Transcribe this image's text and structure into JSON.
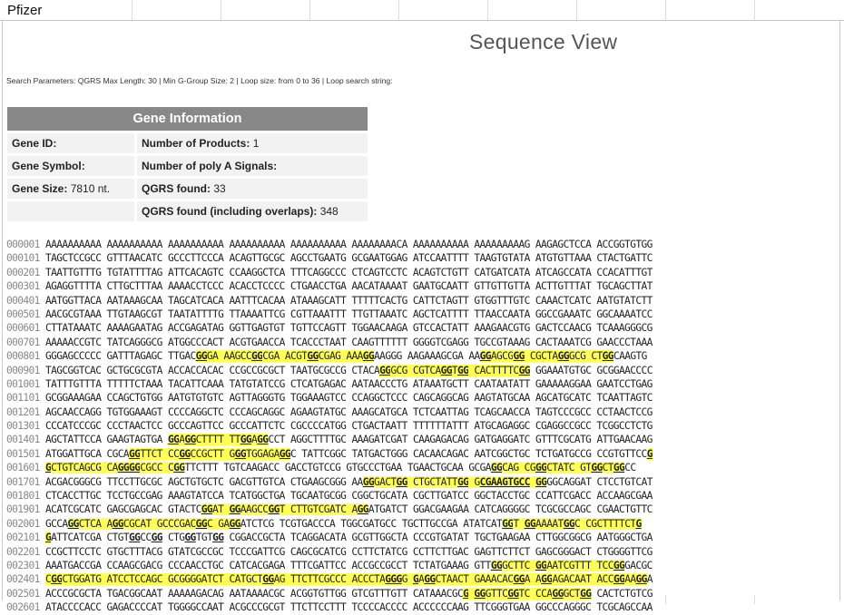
{
  "app": {
    "label": "Pfizer"
  },
  "page": {
    "title": "Sequence View",
    "search_parameters": "Search Parameters: QGRS Max Length: 30 | Min G-Group Size: 2 | Loop size: from 0 to 36 | Loop search string:"
  },
  "gene_info": {
    "header": "Gene Information",
    "rows": [
      {
        "label1": "Gene ID:",
        "value1": "",
        "label2": "Number of Products:",
        "value2": "1"
      },
      {
        "label1": "Gene Symbol:",
        "value1": "",
        "label2": "Number of poly A Signals:",
        "value2": ""
      },
      {
        "label1": "Gene Size:",
        "value1": "7810 nt.",
        "label2": "QGRS found:",
        "value2": "33"
      },
      {
        "label1": "",
        "value1": "",
        "label2": "QGRS found (including overlaps):",
        "value2": "348"
      }
    ]
  },
  "sequence": {
    "markup_legend": "[..] = highlighted QGRS region, {..} = G-group (bold underline)",
    "rows": [
      {
        "num": "000001",
        "seq": "AAAAAAAAAA AAAAAAAAAA AAAAAAAAAA AAAAAAAAAA AAAAAAAAAA AAAAAAAACA AAAAAAAAAA AAAAAAAAAG AAGAGCTCCA ACCGGTGTGG"
      },
      {
        "num": "000101",
        "seq": "TAGCTCCGCC GTTTAACATC GCCCTTCCCA ACAGTTGCGC AGCCTGAATG GCGAATGGAG ATCCAATTTT TAAGTGTATA ATGTGTTAAA CTACTGATTC"
      },
      {
        "num": "000201",
        "seq": "TAATTGTTTG TGTATTTTAG ATTCACAGTC CCAAGGCTCA TTTCAGGCCC CTCAGTCCTC ACAGTCTGTT CATGATCATA ATCAGCCATA CCACATTTGT"
      },
      {
        "num": "000301",
        "seq": "AGAGGTTTTA CTTGCTTTAA AAAACCTCCC ACACCTCCCC CTGAACCTGA AACATAAAAT GAATGCAATT GTTGTTGTTA ACTTGTTTAT TGCAGCTTAT"
      },
      {
        "num": "000401",
        "seq": "AATGGTTACA AATAAAGCAA TAGCATCACA AATTTCACAA ATAAAGCATT TTTTTCACTG CATTCTAGTT GTGGTTTGTC CAAACTCATC AATGTATCTT"
      },
      {
        "num": "000501",
        "seq": "AACGCGTAAA TTGTAAGCGT TAATATTTTG TTAAAATTCG CGTTAAATTT TTGTTAAATC AGCTCATTTT TTAACCAATA GGCCGAAATC GGCAAAATCC"
      },
      {
        "num": "000601",
        "seq": "CTTATAAATC AAAAGAATAG ACCGAGATAG GGTTGAGTGT TGTTCCAGTT TGGAACAAGA GTCCACTATT AAAGAACGTG GACTCCAACG TCAAAGGGCG"
      },
      {
        "num": "000701",
        "seq": "AAAAACCGTC TATCAGGGCG ATGGCCCACT ACGTGAACCA TCACCCTAAT CAAGTTTTTT GGGGTCGAGG TGCCGTAAAG CACTAAATCG GAACCCTAAA"
      },
      {
        "num": "000801",
        "seq": "GGGAGCCCCC GATTTAGAGC TTGAC[{GG}GA AAGCC{GG}CGA ACGT{GG}CGAG AAA{GG}]AAGGG AAGAAAGCGA AA[{GG}AGCG{GG} CGCTA{GG}GCG CT{GG}]CAAGTG"
      },
      {
        "num": "000901",
        "seq": "TAGCGGTCAC GCTGCGCGTA ACCACCACAC CCGCCGCGCT TAATGCGCCG CTACA[{GG}GCG CGTCA{GG}T{GG} CACTTTTC{GG}] GGAAATGTGC GCGGAACCCC"
      },
      {
        "num": "001001",
        "seq": "TATTTGTTTA TTTTTCTAAA TACATTCAAA TATGTATCCG CTCATGAGAC AATAACCCTG ATAAATGCTT CAATAATATT GAAAAAGGAA GAATCCTGAG"
      },
      {
        "num": "001101",
        "seq": "GCGGAAAGAA CCAGCTGTGG AATGTGTGTC AGTTAGGGTG TGGAAAGTCC CCAGGCTCCC CAGCAGGCAG AAGTATGCAA AGCATGCATC TCAATTAGTC"
      },
      {
        "num": "001201",
        "seq": "AGCAACCAGG TGTGGAAAGT CCCCAGGCTC CCCAGCAGGC AGAAGTATGC AAAGCATGCA TCTCAATTAG TCAGCAACCA TAGTCCCGCC CCTAACTCCG"
      },
      {
        "num": "001301",
        "seq": "CCCATCCCGC CCCTAACTCC GCCCAGTTCC GCCCATTCTC CGCCCCATGG CTGACTAATT TTTTTTATTT ATGCAGAGGC CGAGGCCGCC TCGGCCTCTG"
      },
      {
        "num": "001401",
        "seq": "AGCTATTCCA GAAGTAGTGA [{GG}A{GG}CTTTT TT{GG}A{GG}]CCT AGGCTTTTGC AAAGATCGAT CAAGAGACAG GATGAGGATC GTTTCGCATG ATTGAACAAG"
      },
      {
        "num": "001501",
        "seq": "ATGGATTGCA CGCA[{GG}TTCT CC{GG}CCGCTT G{GG}TGGAGA{G}{G}]C TATTCGGC TATGACTGGG CACAACAGAC AATCGGCTGC TCTGATGCCG CCGTGTTCC[{G}"
      },
      {
        "num": "001601",
        "seq": "{G}CTGTCAGCG CA{GGGG}CGCC C{GG}]TTCTTT TGTCAAGACC GACCTGTCCG GTGCCCTGAA TGAACTGCAA GCGA[{GG}CAG CG{GG}CTATC GT{GG}CT{GG}]CC"
      },
      {
        "num": "001701",
        "seq": "ACGACGGGCG TTCCTTGCGC AGCTGTGCTC GACGTTGTCA CTGAAGCGGG AA[{GG}GACT{GG} CTGCTATT{GG} G{CGAAGTGCC} {GG}]GGCAGGAT CTCCTGTCAT"
      },
      {
        "num": "001801",
        "seq": "CTCACCTTGC TCCTGCCGAG AAAGTATCCA TCATGGCTGA TGCAATGCGG CGGCTGCATA CGCTTGATCC GGCTACCTGC CCATTCGACC ACCAAGCGAA"
      },
      {
        "num": "001901",
        "seq": "ACATCGCATC GAGCGAGCAC GTACTC[{GG}AT {GG}AAGCC{GG}T CTTGTCGATC A{GG}]ATGATCT GGACGAAGAA CATCAGGGGC TCGCGCCAGC CGAACTGTTC"
      },
      {
        "num": "002001",
        "seq": "GCCA[{GG}CTCA A{GG}CGCAT GCCCGAC{GG}C GA{GG}]ATCTCG TCGTGACCCA TGGCGATGCC TGCTTGCCGA ATATCAT[{GG}T {GG}AAAAT{GG}C CGCTTTTCT{G}"
      },
      {
        "num": "002101",
        "seq": "{G}]ATTCATCGA CTGT{GG}CC{GG} CTG{GG}TGT{GG} CGGACCGCTA TCAGGACATA GCGTTGGCTA CCCGTGATAT TGCTGAAGAA CTTGGCGGCG AATGGGCTGA"
      },
      {
        "num": "002201",
        "seq": "CCGCTTCCTC GTGCTTTACG GTATCGCCGC TCCCGATTCG CAGCGCATCG CCTTCTATCG CCTTCTTGAC GAGTTCTTCT GAGCGGGACT CTGGGGTTCG"
      },
      {
        "num": "002301",
        "seq": "AAATGACCGA CCAAGCGACG CCCAACCTGC CATCACGAGA TTTCGATTCC ACCGCCGCCT TCTATGAAAG GTT[{GG}GCTTC {GG}AATCGTTT TCC{GG}]GACGC"
      },
      {
        "num": "002401",
        "seq": "[C{GG}CTGGATG ATCCTCCAGC GCGGGGATCT CATGCT{GG}AG TTCTTCGCCC ACCCTA{GGG}G {G}A{GG}CTAACT GAAACAC{GG}A A{GG}AGACAAT ACC{GG}AA{GG}]A"
      },
      {
        "num": "002501",
        "seq": "ACCCGCGCTA TGACGGCAAT AAAAAGACAG AATAAAACGC ACGGTGTTGG GTCGTTTGTT CATAAACGC[{G} {GG}GTTC{GG}TC CCA{GG}GCT{GG}] CACTCTGTCG"
      },
      {
        "num": "002601",
        "seq": "ATACCCCACC GAGACCCCAT TGGGGCCAAT ACGCCCGCGT TTCTTCCTTT TCCCCACCCC ACCCCCCAAG TTCGGGTGAA GGCCCAGGGC TCGCAGCCAA"
      }
    ]
  }
}
